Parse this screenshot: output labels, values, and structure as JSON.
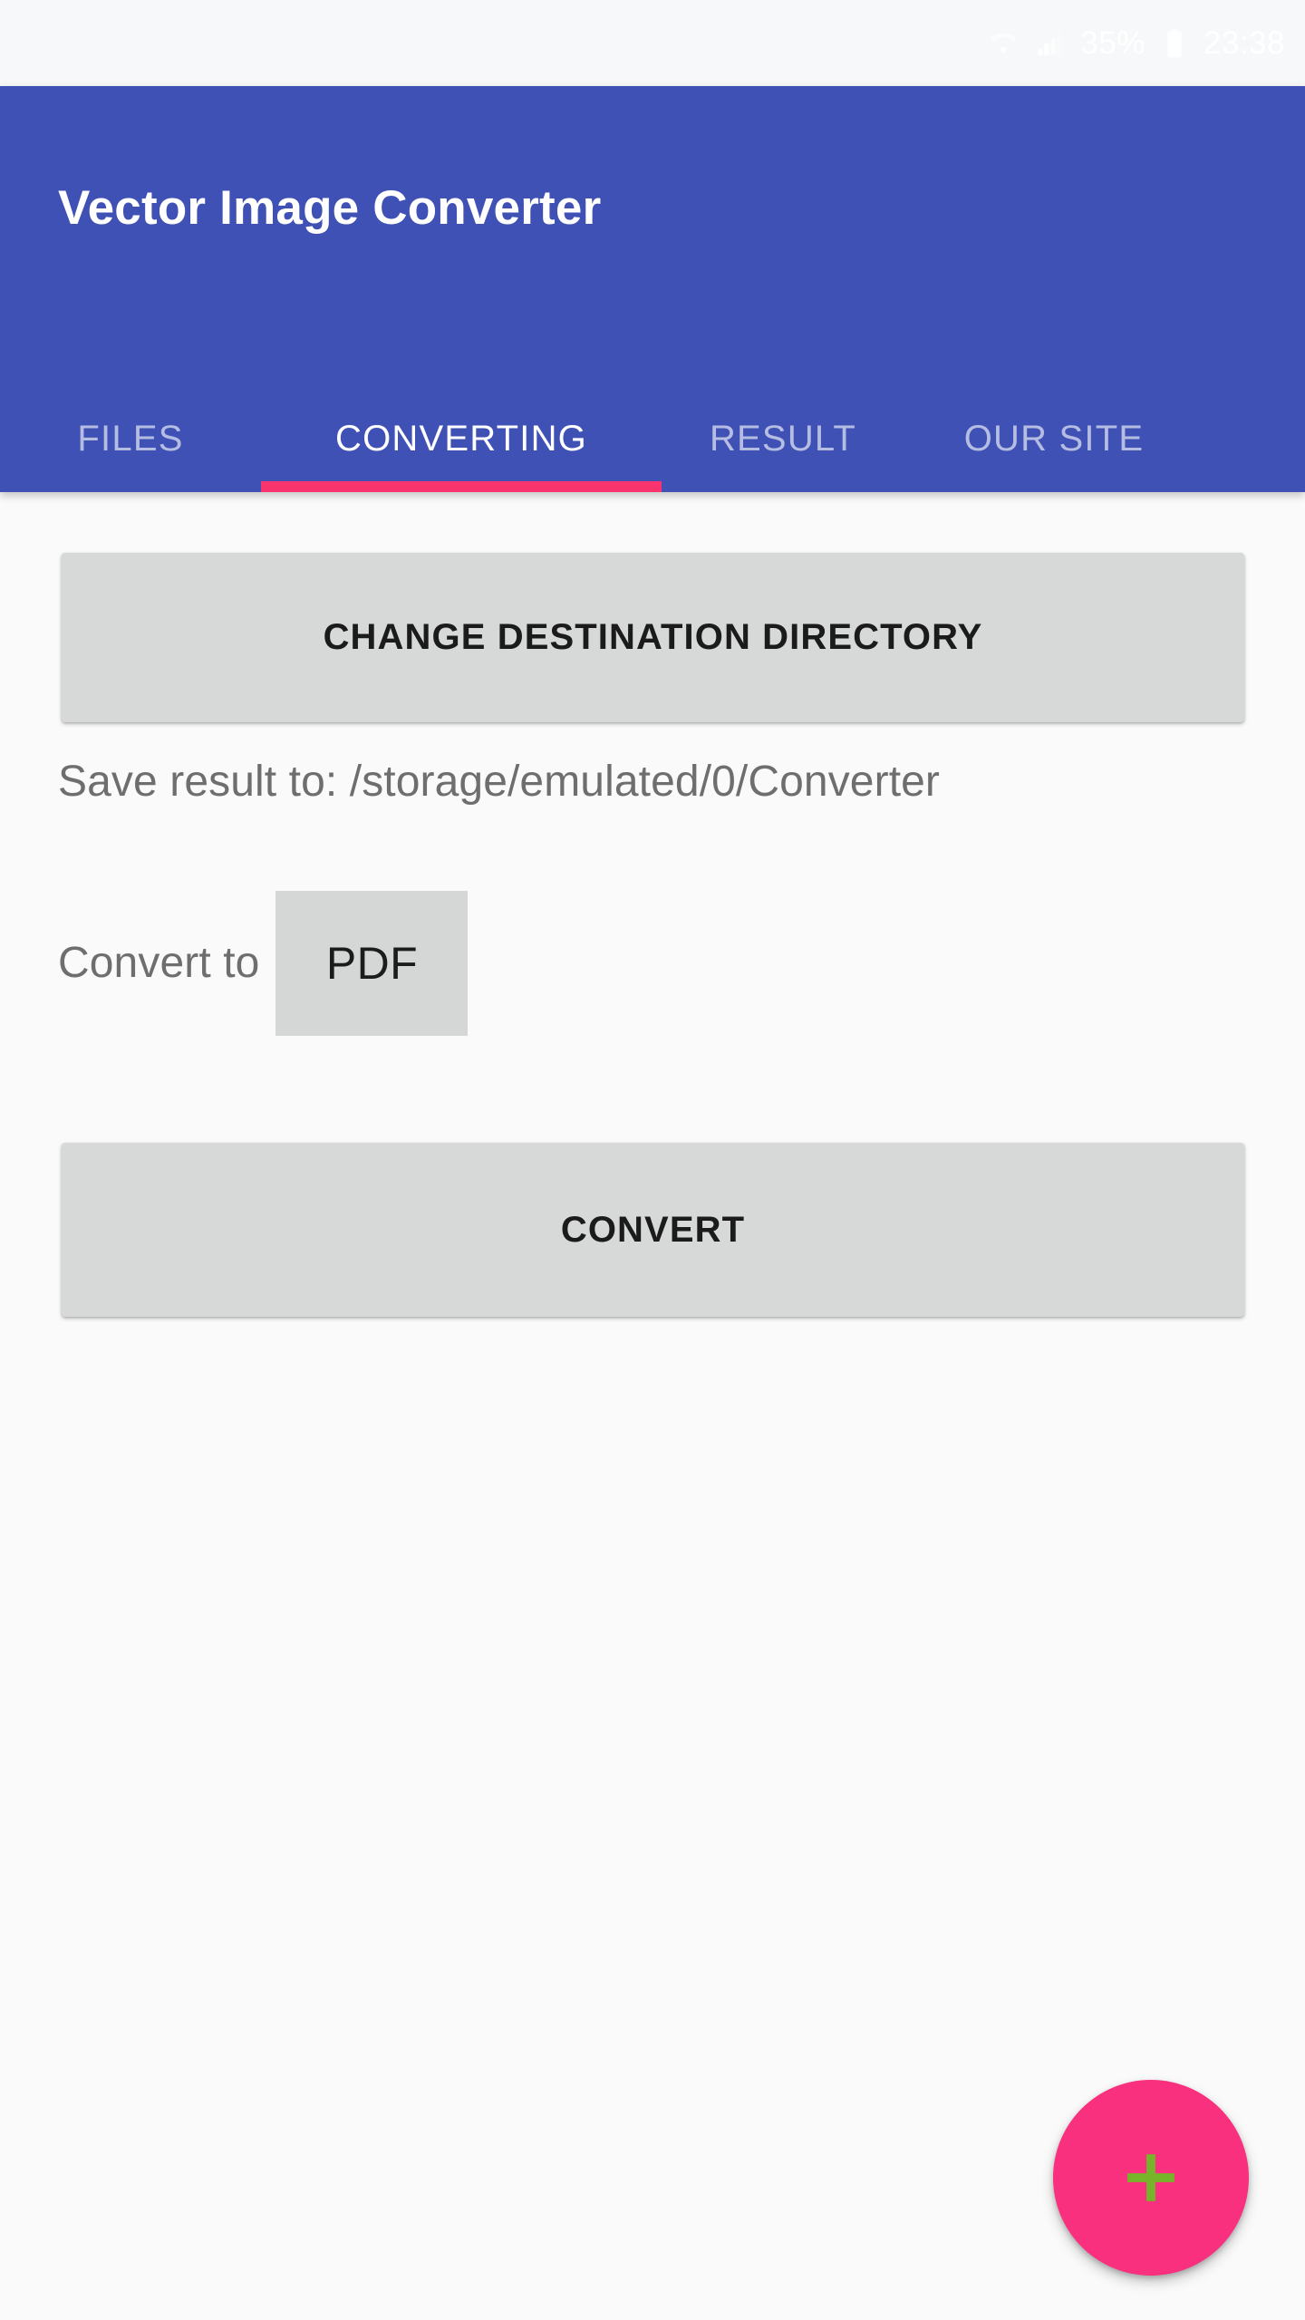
{
  "status_bar": {
    "wifi_icon": "wifi-icon",
    "signal_icon": "signal-bars-icon",
    "battery_level": "35%",
    "battery_icon": "battery-icon",
    "time": "23:38"
  },
  "app_bar": {
    "title": "Vector Image Converter",
    "background_color": "#3f51b5",
    "title_color": "#ffffff",
    "tabs": [
      {
        "label": "FILES",
        "active": false
      },
      {
        "label": "CONVERTING",
        "active": true
      },
      {
        "label": "RESULT",
        "active": false
      },
      {
        "label": "OUR SITE",
        "active": false
      }
    ],
    "indicator_color": "#f8336e"
  },
  "main": {
    "change_directory_button": "CHANGE DESTINATION DIRECTORY",
    "save_path_text": "Save result to: /storage/emulated/0/Converter",
    "convert_to_label": "Convert to",
    "format_selected": "PDF",
    "convert_button": "CONVERT",
    "button_color": "#d7d8d8",
    "body_text_color": "#6e6e6e"
  },
  "fab": {
    "icon": "plus-icon",
    "background_color": "#f8307d",
    "icon_color": "#76b52a"
  }
}
